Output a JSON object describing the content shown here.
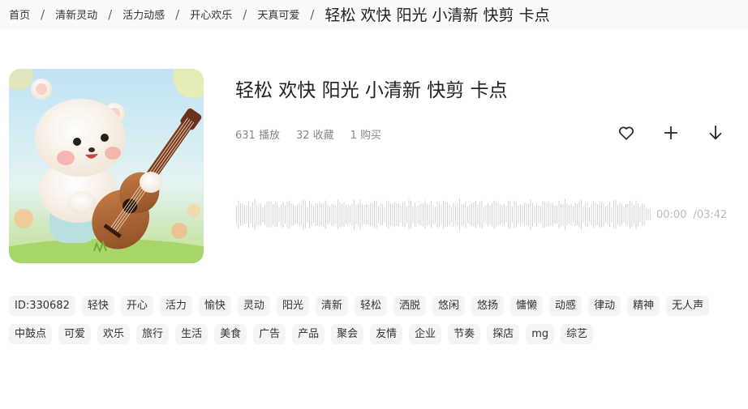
{
  "breadcrumb": {
    "items": [
      "首页",
      "清新灵动",
      "活力动感",
      "开心欢乐",
      "天真可爱"
    ],
    "separator": "/",
    "current": "轻松 欢快 阳光 小清新 快剪 卡点"
  },
  "track": {
    "title": "轻松 欢快 阳光 小清新 快剪 卡点",
    "stats": {
      "plays": "631 播放",
      "favorites": "32 收藏",
      "purchases": "1 购买"
    },
    "actions": [
      "heart-icon",
      "plus-icon",
      "download-icon"
    ],
    "player": {
      "current_time": "00:00",
      "duration": "/03:42"
    }
  },
  "tags": [
    "ID:330682",
    "轻快",
    "开心",
    "活力",
    "愉快",
    "灵动",
    "阳光",
    "清新",
    "轻松",
    "洒脱",
    "悠闲",
    "悠扬",
    "慵懒",
    "动感",
    "律动",
    "精神",
    "无人声",
    "中鼓点",
    "可爱",
    "欢乐",
    "旅行",
    "生活",
    "美食",
    "广告",
    "产品",
    "聚会",
    "友情",
    "企业",
    "节奏",
    "探店",
    "mg",
    "综艺"
  ],
  "colors": {
    "tag_bg": "#f4f4f4",
    "waveform": "#d6d6d6",
    "muted_text": "#888888"
  }
}
